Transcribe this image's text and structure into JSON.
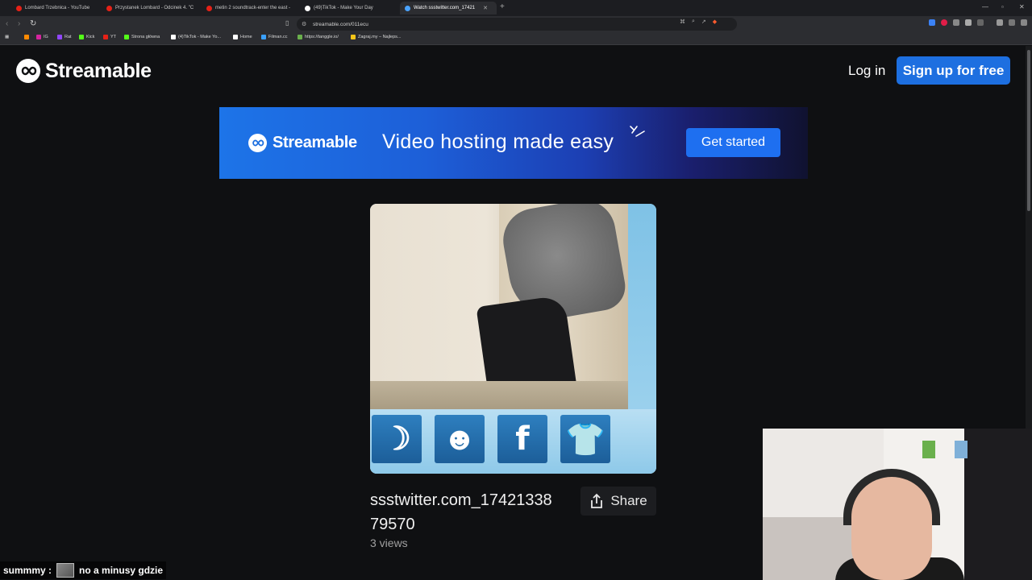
{
  "browser": {
    "tabs": [
      {
        "title": "Lombard Trzebnica - YouTube",
        "favicon_color": "#e62117",
        "active": false
      },
      {
        "title": "Przystanek Lombard - Odcinek 4. \"C",
        "favicon_color": "#e62117",
        "active": false
      },
      {
        "title": "metin 2 soundtrack-enter the east -",
        "favicon_color": "#e62117",
        "active": false
      },
      {
        "title": "(49)TikTok - Make Your Day",
        "favicon_color": "#ffffff",
        "active": false
      },
      {
        "title": "Watch ssstwitter.com_17421",
        "favicon_color": "#4aa3ff",
        "active": true
      }
    ],
    "url": "streamable.com/011ecu",
    "bookmarks": [
      {
        "label": "",
        "color": "#ff8a00"
      },
      {
        "label": "IG",
        "color": "#d6249f"
      },
      {
        "label": "Rat",
        "color": "#9146ff"
      },
      {
        "label": "Kick",
        "color": "#53fc18"
      },
      {
        "label": "YT",
        "color": "#e62117"
      },
      {
        "label": "Strona główna",
        "color": "#53fc18"
      },
      {
        "label": "(4)TikTok - Make Yo...",
        "color": "#ffffff"
      },
      {
        "label": "Home",
        "color": "#ffffff"
      },
      {
        "label": "Filman.cc",
        "color": "#3aa0ff"
      },
      {
        "label": "https://tanggle.io/",
        "color": "#6ab04c"
      },
      {
        "label": "Zagraj.my – Najleps...",
        "color": "#f5c518"
      }
    ]
  },
  "site": {
    "brand": "Streamable",
    "login_label": "Log in",
    "signup_label": "Sign up for free",
    "accent_color": "#1d6fe0"
  },
  "banner": {
    "brand": "Streamable",
    "tagline": "Video hosting made easy",
    "cta_label": "Get started"
  },
  "video": {
    "title": "ssstwitter.com_17421338 79570",
    "views": "3 views",
    "share_label": "Share",
    "overlay_icons": [
      "shaman-icon",
      "group-icon",
      "facebook-icon",
      "tshirt-icon"
    ]
  },
  "chat": {
    "username": "summmy :",
    "message": "no a minusy gdzie"
  }
}
